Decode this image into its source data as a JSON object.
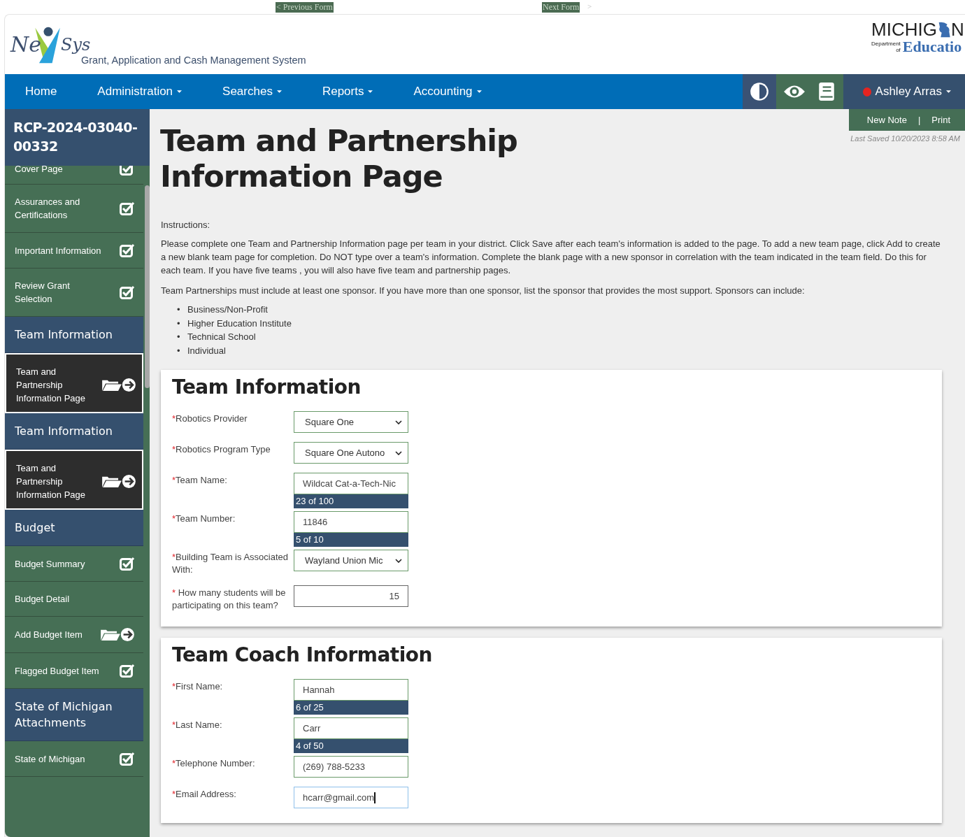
{
  "top_links": [
    {
      "label": "< Previous Form"
    },
    {
      "label": "Next Form"
    }
  ],
  "next_arrow": ">",
  "header": {
    "logo_left": "Ne",
    "logo_right": "Sys",
    "subtitle": "Grant, Application and Cash Management System",
    "agency_top_a": "MICHIG",
    "agency_top_b": "N",
    "agency_small_a": "Department",
    "agency_small_b": "of",
    "agency_bottom": "Educatio"
  },
  "nav": {
    "items": [
      {
        "label": "Home",
        "dropdown": false
      },
      {
        "label": "Administration",
        "dropdown": true
      },
      {
        "label": "Searches",
        "dropdown": true
      },
      {
        "label": "Reports",
        "dropdown": true
      },
      {
        "label": "Accounting",
        "dropdown": true
      }
    ],
    "user": {
      "name": "Ashley Arras",
      "color": "#e52421"
    }
  },
  "notes_bar": {
    "new_note": "New Note",
    "separator": "|",
    "print": "Print",
    "last_saved": "Last Saved 10/20/2023 8:58 AM"
  },
  "sidebar": {
    "title": "RCP-2024-03040-00332",
    "items": [
      {
        "kind": "complete",
        "label": "Cover Page",
        "selected": false
      },
      {
        "kind": "complete",
        "label": "Assurances and Certifications",
        "selected": false
      },
      {
        "kind": "complete",
        "label": "Important Information",
        "selected": false
      },
      {
        "kind": "complete",
        "label": "Review Grant Selection",
        "selected": false
      },
      {
        "kind": "section",
        "label": "Team Information"
      },
      {
        "kind": "add",
        "label": "Team and Partnership Information Page",
        "selected": true
      },
      {
        "kind": "section",
        "label": "Team Information"
      },
      {
        "kind": "add",
        "label": "Team and Partnership Information Page",
        "selected": true
      },
      {
        "kind": "section",
        "label": "Budget"
      },
      {
        "kind": "complete",
        "label": "Budget Summary",
        "selected": false
      },
      {
        "kind": "plain",
        "label": "Budget Detail",
        "selected": false
      },
      {
        "kind": "add",
        "label": "Add Budget Item",
        "selected": false
      },
      {
        "kind": "complete",
        "label": "Flagged Budget Item",
        "selected": false
      },
      {
        "kind": "section",
        "label": "State of Michigan Attachments"
      },
      {
        "kind": "complete",
        "label": "State of Michigan",
        "selected": false
      }
    ]
  },
  "page": {
    "title": "Team and Partnership Information Page",
    "instructions_label": "Instructions:",
    "paragraphs": [
      "Please complete one Team and Partnership Information page per team in your district. Click Save after each team's information is added to the page. To add a new team page, click Add to create a new blank team page for completion. Do NOT type over a team's information. Complete the blank page with a new sponsor in correlation with the team indicated in the team field. Do this for each team. If you have five teams , you will also have five team and partnership pages.",
      "Team Partnerships must include at least one sponsor. If you have more than one sponsor, list the sponsor that provides the most support. Sponsors can include:"
    ],
    "bullet": "•",
    "sponsor_types": [
      "Business/Non-Profit",
      "Higher Education Institute",
      "Technical School",
      "Individual"
    ]
  },
  "sections": [
    {
      "title": "Team Information",
      "fields": [
        {
          "kind": "select",
          "required": "*",
          "label": "Robotics Provider",
          "value": "Square One",
          "focused": false
        },
        {
          "kind": "select",
          "required": "*",
          "label": "Robotics Program Type",
          "value": "Square One Autono",
          "focused": false
        },
        {
          "kind": "text",
          "required": "*",
          "label": "Team Name:",
          "value": "Wildcat Cat-a-Tech-Nic",
          "counter": "23 of 100",
          "focused": false
        },
        {
          "kind": "text",
          "required": "*",
          "label": "Team Number:",
          "value": "11846",
          "counter": "5 of 10",
          "focused": false
        },
        {
          "kind": "select",
          "required": "*",
          "label": "Building Team is Associated With:",
          "value": "Wayland Union Mic",
          "focused": false
        },
        {
          "kind": "number",
          "required": "*",
          "label": " How many students will be participating on this team?",
          "value": "15",
          "focused": false
        }
      ]
    },
    {
      "title": "Team Coach Information",
      "fields": [
        {
          "kind": "text",
          "required": "*",
          "label": "First Name:",
          "value": "Hannah",
          "counter": "6 of 25",
          "focused": false
        },
        {
          "kind": "text",
          "required": "*",
          "label": "Last Name:",
          "value": "Carr",
          "counter": "4 of 50",
          "focused": false
        },
        {
          "kind": "text",
          "required": "*",
          "label": "Telephone Number:",
          "value": "(269) 788-5233",
          "focused": false
        },
        {
          "kind": "text",
          "required": "*",
          "label": "Email Address:",
          "value": "hcarr@gmail.com",
          "focused": true
        }
      ]
    }
  ]
}
